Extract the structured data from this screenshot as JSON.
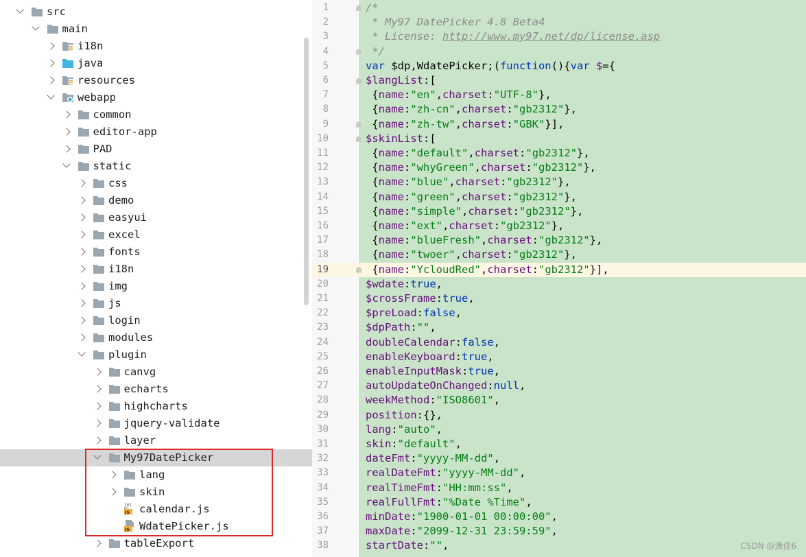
{
  "tree": [
    {
      "label": "src",
      "depth": 0,
      "state": "open",
      "icon": "folder"
    },
    {
      "label": "main",
      "depth": 1,
      "state": "open",
      "icon": "folder"
    },
    {
      "label": "i18n",
      "depth": 2,
      "state": "closed",
      "icon": "resource-folder"
    },
    {
      "label": "java",
      "depth": 2,
      "state": "closed",
      "icon": "source-folder"
    },
    {
      "label": "resources",
      "depth": 2,
      "state": "closed",
      "icon": "resource-folder"
    },
    {
      "label": "webapp",
      "depth": 2,
      "state": "open",
      "icon": "web-folder"
    },
    {
      "label": "common",
      "depth": 3,
      "state": "closed",
      "icon": "folder"
    },
    {
      "label": "editor-app",
      "depth": 3,
      "state": "closed",
      "icon": "folder"
    },
    {
      "label": "PAD",
      "depth": 3,
      "state": "closed",
      "icon": "folder"
    },
    {
      "label": "static",
      "depth": 3,
      "state": "open",
      "icon": "folder"
    },
    {
      "label": "css",
      "depth": 4,
      "state": "closed",
      "icon": "folder"
    },
    {
      "label": "demo",
      "depth": 4,
      "state": "closed",
      "icon": "folder"
    },
    {
      "label": "easyui",
      "depth": 4,
      "state": "closed",
      "icon": "folder"
    },
    {
      "label": "excel",
      "depth": 4,
      "state": "closed",
      "icon": "folder"
    },
    {
      "label": "fonts",
      "depth": 4,
      "state": "closed",
      "icon": "folder"
    },
    {
      "label": "i18n",
      "depth": 4,
      "state": "closed",
      "icon": "folder"
    },
    {
      "label": "img",
      "depth": 4,
      "state": "closed",
      "icon": "folder"
    },
    {
      "label": "js",
      "depth": 4,
      "state": "closed",
      "icon": "folder"
    },
    {
      "label": "login",
      "depth": 4,
      "state": "closed",
      "icon": "folder"
    },
    {
      "label": "modules",
      "depth": 4,
      "state": "closed",
      "icon": "folder"
    },
    {
      "label": "plugin",
      "depth": 4,
      "state": "open",
      "icon": "folder"
    },
    {
      "label": "canvg",
      "depth": 5,
      "state": "closed",
      "icon": "folder"
    },
    {
      "label": "echarts",
      "depth": 5,
      "state": "closed",
      "icon": "folder"
    },
    {
      "label": "highcharts",
      "depth": 5,
      "state": "closed",
      "icon": "folder"
    },
    {
      "label": "jquery-validate",
      "depth": 5,
      "state": "closed",
      "icon": "folder"
    },
    {
      "label": "layer",
      "depth": 5,
      "state": "closed",
      "icon": "folder"
    },
    {
      "label": "My97DatePicker",
      "depth": 5,
      "state": "open",
      "icon": "folder",
      "selected": true
    },
    {
      "label": "lang",
      "depth": 6,
      "state": "closed",
      "icon": "folder"
    },
    {
      "label": "skin",
      "depth": 6,
      "state": "closed",
      "icon": "folder"
    },
    {
      "label": "calendar.js",
      "depth": 6,
      "state": "leaf",
      "icon": "js-binary-file"
    },
    {
      "label": "WdatePicker.js",
      "depth": 6,
      "state": "leaf",
      "icon": "js-file"
    },
    {
      "label": "tableExport",
      "depth": 5,
      "state": "closed",
      "icon": "folder"
    }
  ],
  "editor": {
    "current_line": 19,
    "lines": [
      {
        "n": 1,
        "fold": true,
        "tokens": [
          [
            "cm",
            "/*"
          ]
        ]
      },
      {
        "n": 2,
        "tokens": [
          [
            "cm",
            " * My97 DatePicker 4.8 Beta4"
          ]
        ]
      },
      {
        "n": 3,
        "tokens": [
          [
            "cm",
            " * License: "
          ],
          [
            "link",
            "http://www.my97.net/dp/license.asp"
          ]
        ]
      },
      {
        "n": 4,
        "fold": true,
        "tokens": [
          [
            "cm",
            " */"
          ]
        ]
      },
      {
        "n": 5,
        "tokens": [
          [
            "kw",
            "var "
          ],
          [
            "p",
            "$dp,WdatePicker;("
          ],
          [
            "kw",
            "function"
          ],
          [
            "p",
            "(){"
          ],
          [
            "kw",
            "var "
          ],
          [
            "var",
            "$"
          ],
          [
            "p",
            "={"
          ]
        ]
      },
      {
        "n": 6,
        "fold": true,
        "tokens": [
          [
            "var",
            "$langList"
          ],
          [
            "p",
            ":["
          ]
        ]
      },
      {
        "n": 7,
        "tokens": [
          [
            "p",
            " {"
          ],
          [
            "var",
            "name"
          ],
          [
            "p",
            ":"
          ],
          [
            "str",
            "\"en\""
          ],
          [
            "p",
            ","
          ],
          [
            "var",
            "charset"
          ],
          [
            "p",
            ":"
          ],
          [
            "str",
            "\"UTF-8\""
          ],
          [
            "p",
            "},"
          ]
        ]
      },
      {
        "n": 8,
        "tokens": [
          [
            "p",
            " {"
          ],
          [
            "var",
            "name"
          ],
          [
            "p",
            ":"
          ],
          [
            "str",
            "\"zh-cn\""
          ],
          [
            "p",
            ","
          ],
          [
            "var",
            "charset"
          ],
          [
            "p",
            ":"
          ],
          [
            "str",
            "\"gb2312\""
          ],
          [
            "p",
            "},"
          ]
        ]
      },
      {
        "n": 9,
        "fold": true,
        "tokens": [
          [
            "p",
            " {"
          ],
          [
            "var",
            "name"
          ],
          [
            "p",
            ":"
          ],
          [
            "str",
            "\"zh-tw\""
          ],
          [
            "p",
            ","
          ],
          [
            "var",
            "charset"
          ],
          [
            "p",
            ":"
          ],
          [
            "str",
            "\"GBK\""
          ],
          [
            "p",
            "}],"
          ]
        ]
      },
      {
        "n": 10,
        "fold": true,
        "tokens": [
          [
            "var",
            "$skinList"
          ],
          [
            "p",
            ":["
          ]
        ]
      },
      {
        "n": 11,
        "tokens": [
          [
            "p",
            " {"
          ],
          [
            "var",
            "name"
          ],
          [
            "p",
            ":"
          ],
          [
            "str",
            "\"default\""
          ],
          [
            "p",
            ","
          ],
          [
            "var",
            "charset"
          ],
          [
            "p",
            ":"
          ],
          [
            "str",
            "\"gb2312\""
          ],
          [
            "p",
            "},"
          ]
        ]
      },
      {
        "n": 12,
        "tokens": [
          [
            "p",
            " {"
          ],
          [
            "var",
            "name"
          ],
          [
            "p",
            ":"
          ],
          [
            "str",
            "\"whyGreen\""
          ],
          [
            "p",
            ","
          ],
          [
            "var",
            "charset"
          ],
          [
            "p",
            ":"
          ],
          [
            "str",
            "\"gb2312\""
          ],
          [
            "p",
            "},"
          ]
        ]
      },
      {
        "n": 13,
        "tokens": [
          [
            "p",
            " {"
          ],
          [
            "var",
            "name"
          ],
          [
            "p",
            ":"
          ],
          [
            "str",
            "\"blue\""
          ],
          [
            "p",
            ","
          ],
          [
            "var",
            "charset"
          ],
          [
            "p",
            ":"
          ],
          [
            "str",
            "\"gb2312\""
          ],
          [
            "p",
            "},"
          ]
        ]
      },
      {
        "n": 14,
        "tokens": [
          [
            "p",
            " {"
          ],
          [
            "var",
            "name"
          ],
          [
            "p",
            ":"
          ],
          [
            "str",
            "\"green\""
          ],
          [
            "p",
            ","
          ],
          [
            "var",
            "charset"
          ],
          [
            "p",
            ":"
          ],
          [
            "str",
            "\"gb2312\""
          ],
          [
            "p",
            "},"
          ]
        ]
      },
      {
        "n": 15,
        "tokens": [
          [
            "p",
            " {"
          ],
          [
            "var",
            "name"
          ],
          [
            "p",
            ":"
          ],
          [
            "str",
            "\"simple\""
          ],
          [
            "p",
            ","
          ],
          [
            "var",
            "charset"
          ],
          [
            "p",
            ":"
          ],
          [
            "str",
            "\"gb2312\""
          ],
          [
            "p",
            "},"
          ]
        ]
      },
      {
        "n": 16,
        "tokens": [
          [
            "p",
            " {"
          ],
          [
            "var",
            "name"
          ],
          [
            "p",
            ":"
          ],
          [
            "str",
            "\"ext\""
          ],
          [
            "p",
            ","
          ],
          [
            "var",
            "charset"
          ],
          [
            "p",
            ":"
          ],
          [
            "str",
            "\"gb2312\""
          ],
          [
            "p",
            "},"
          ]
        ]
      },
      {
        "n": 17,
        "tokens": [
          [
            "p",
            " {"
          ],
          [
            "var",
            "name"
          ],
          [
            "p",
            ":"
          ],
          [
            "str",
            "\"blueFresh\""
          ],
          [
            "p",
            ","
          ],
          [
            "var",
            "charset"
          ],
          [
            "p",
            ":"
          ],
          [
            "str",
            "\"gb2312\""
          ],
          [
            "p",
            "},"
          ]
        ]
      },
      {
        "n": 18,
        "tokens": [
          [
            "p",
            " {"
          ],
          [
            "var",
            "name"
          ],
          [
            "p",
            ":"
          ],
          [
            "str",
            "\"twoer\""
          ],
          [
            "p",
            ","
          ],
          [
            "var",
            "charset"
          ],
          [
            "p",
            ":"
          ],
          [
            "str",
            "\"gb2312\""
          ],
          [
            "p",
            "},"
          ]
        ]
      },
      {
        "n": 19,
        "fold": true,
        "tokens": [
          [
            "p",
            " {"
          ],
          [
            "var",
            "name"
          ],
          [
            "p",
            ":"
          ],
          [
            "str",
            "\"YcloudRed\""
          ],
          [
            "p",
            ","
          ],
          [
            "var",
            "charset"
          ],
          [
            "p",
            ":"
          ],
          [
            "str",
            "\"gb2312\""
          ],
          [
            "p",
            "}],"
          ]
        ]
      },
      {
        "n": 20,
        "tokens": [
          [
            "var",
            "$wdate"
          ],
          [
            "p",
            ":"
          ],
          [
            "kw",
            "true"
          ],
          [
            "p",
            ","
          ]
        ]
      },
      {
        "n": 21,
        "tokens": [
          [
            "var",
            "$crossFrame"
          ],
          [
            "p",
            ":"
          ],
          [
            "kw",
            "true"
          ],
          [
            "p",
            ","
          ]
        ]
      },
      {
        "n": 22,
        "tokens": [
          [
            "var",
            "$preLoad"
          ],
          [
            "p",
            ":"
          ],
          [
            "kw",
            "false"
          ],
          [
            "p",
            ","
          ]
        ]
      },
      {
        "n": 23,
        "tokens": [
          [
            "var",
            "$dpPath"
          ],
          [
            "p",
            ":"
          ],
          [
            "str",
            "\"\""
          ],
          [
            "p",
            ","
          ]
        ]
      },
      {
        "n": 24,
        "tokens": [
          [
            "var",
            "doubleCalendar"
          ],
          [
            "p",
            ":"
          ],
          [
            "kw",
            "false"
          ],
          [
            "p",
            ","
          ]
        ]
      },
      {
        "n": 25,
        "tokens": [
          [
            "var",
            "enableKeyboard"
          ],
          [
            "p",
            ":"
          ],
          [
            "kw",
            "true"
          ],
          [
            "p",
            ","
          ]
        ]
      },
      {
        "n": 26,
        "tokens": [
          [
            "var",
            "enableInputMask"
          ],
          [
            "p",
            ":"
          ],
          [
            "kw",
            "true"
          ],
          [
            "p",
            ","
          ]
        ]
      },
      {
        "n": 27,
        "tokens": [
          [
            "var",
            "autoUpdateOnChanged"
          ],
          [
            "p",
            ":"
          ],
          [
            "kw",
            "null"
          ],
          [
            "p",
            ","
          ]
        ]
      },
      {
        "n": 28,
        "tokens": [
          [
            "var",
            "weekMethod"
          ],
          [
            "p",
            ":"
          ],
          [
            "str",
            "\"ISO8601\""
          ],
          [
            "p",
            ","
          ]
        ]
      },
      {
        "n": 29,
        "tokens": [
          [
            "var",
            "position"
          ],
          [
            "p",
            ":{},"
          ]
        ]
      },
      {
        "n": 30,
        "tokens": [
          [
            "var",
            "lang"
          ],
          [
            "p",
            ":"
          ],
          [
            "str",
            "\"auto\""
          ],
          [
            "p",
            ","
          ]
        ]
      },
      {
        "n": 31,
        "tokens": [
          [
            "var",
            "skin"
          ],
          [
            "p",
            ":"
          ],
          [
            "str",
            "\"default\""
          ],
          [
            "p",
            ","
          ]
        ]
      },
      {
        "n": 32,
        "tokens": [
          [
            "var",
            "dateFmt"
          ],
          [
            "p",
            ":"
          ],
          [
            "str",
            "\"yyyy-MM-dd\""
          ],
          [
            "p",
            ","
          ]
        ]
      },
      {
        "n": 33,
        "tokens": [
          [
            "var",
            "realDateFmt"
          ],
          [
            "p",
            ":"
          ],
          [
            "str",
            "\"yyyy-MM-dd\""
          ],
          [
            "p",
            ","
          ]
        ]
      },
      {
        "n": 34,
        "tokens": [
          [
            "var",
            "realTimeFmt"
          ],
          [
            "p",
            ":"
          ],
          [
            "str",
            "\"HH:mm:ss\""
          ],
          [
            "p",
            ","
          ]
        ]
      },
      {
        "n": 35,
        "tokens": [
          [
            "var",
            "realFullFmt"
          ],
          [
            "p",
            ":"
          ],
          [
            "str",
            "\"%Date %Time\""
          ],
          [
            "p",
            ","
          ]
        ]
      },
      {
        "n": 36,
        "tokens": [
          [
            "var",
            "minDate"
          ],
          [
            "p",
            ":"
          ],
          [
            "str",
            "\"1900-01-01 00:00:00\""
          ],
          [
            "p",
            ","
          ]
        ]
      },
      {
        "n": 37,
        "tokens": [
          [
            "var",
            "maxDate"
          ],
          [
            "p",
            ":"
          ],
          [
            "str",
            "\"2099-12-31 23:59:59\""
          ],
          [
            "p",
            ","
          ]
        ]
      },
      {
        "n": 38,
        "tokens": [
          [
            "var",
            "startDate"
          ],
          [
            "p",
            ":"
          ],
          [
            "str",
            "\"\""
          ],
          [
            "p",
            ","
          ]
        ]
      }
    ]
  },
  "watermark": "CSDN @逸佳6",
  "colors": {
    "diff_added_bg": "#c9e4c9",
    "selection_bg": "#d6d6d6",
    "highlight_box": "#e0262d",
    "keyword": "#0033b3",
    "property": "#660e7a",
    "string": "#067d17",
    "comment": "#8c8c8c"
  }
}
